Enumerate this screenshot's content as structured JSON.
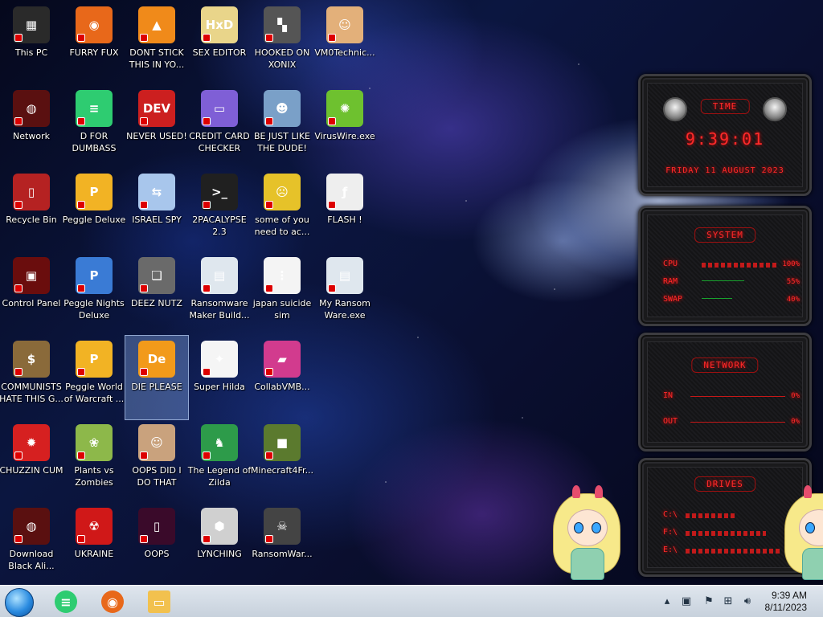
{
  "desktop": {
    "icons": [
      {
        "label": "This PC",
        "color": "#2a2a2a",
        "glyph": "▦"
      },
      {
        "label": "FURRY FUX",
        "color": "#e8681a",
        "glyph": "◉"
      },
      {
        "label": "DONT STICK THIS IN YO...",
        "color": "#f08a1a",
        "glyph": "▲"
      },
      {
        "label": "SEX EDITOR",
        "color": "#e9d58a",
        "glyph": "HxD"
      },
      {
        "label": "HOOKED ON XONIX",
        "color": "#555555",
        "glyph": "▚"
      },
      {
        "label": "VM0Technic...",
        "color": "#e3b07a",
        "glyph": "☺"
      },
      {
        "label": "Network",
        "color": "#5a1010",
        "glyph": "◍"
      },
      {
        "label": "D FOR DUMBASS",
        "color": "#2ecc71",
        "glyph": "≡"
      },
      {
        "label": "NEVER USED!",
        "color": "#cc1f1f",
        "glyph": "DEV"
      },
      {
        "label": "CREDIT CARD CHECKER",
        "color": "#7f5fd6",
        "glyph": "▭"
      },
      {
        "label": "BE JUST LIKE THE DUDE!",
        "color": "#7aa0c8",
        "glyph": "☻"
      },
      {
        "label": "VirusWire.exe",
        "color": "#6ec12f",
        "glyph": "✺"
      },
      {
        "label": "Recycle Bin",
        "color": "#b52222",
        "glyph": "▯"
      },
      {
        "label": "Peggle Deluxe",
        "color": "#f2b324",
        "glyph": "P"
      },
      {
        "label": "ISRAEL SPY",
        "color": "#a8c6ec",
        "glyph": "⇆"
      },
      {
        "label": "2PACALYPSE 2.3",
        "color": "#202020",
        "glyph": ">_"
      },
      {
        "label": "some of you need to ac...",
        "color": "#e6c229",
        "glyph": "☹"
      },
      {
        "label": "FLASH !",
        "color": "#eeeeee",
        "glyph": "ƒ"
      },
      {
        "label": "Control Panel",
        "color": "#6a0d0d",
        "glyph": "▣"
      },
      {
        "label": "Peggle Nights Deluxe",
        "color": "#3a7bd5",
        "glyph": "P"
      },
      {
        "label": "DEEZ NUTZ",
        "color": "#6a6a6a",
        "glyph": "❏"
      },
      {
        "label": "Ransomware Maker Build...",
        "color": "#dfe7ee",
        "glyph": "▤"
      },
      {
        "label": "japan suicide sim",
        "color": "#f4f4f4",
        "glyph": "⋮"
      },
      {
        "label": "My Ransom Ware.exe",
        "color": "#dfe7ee",
        "glyph": "▤"
      },
      {
        "label": "COMMUNISTS HATE THIS G...",
        "color": "#8a6a3a",
        "glyph": "$"
      },
      {
        "label": "Peggle World of Warcraft ...",
        "color": "#f2b324",
        "glyph": "P"
      },
      {
        "label": "DIE PLEASE",
        "color": "#f29a1a",
        "glyph": "De"
      },
      {
        "label": "Super Hilda",
        "color": "#f5f5f5",
        "glyph": "✦"
      },
      {
        "label": "CollabVMB...",
        "color": "#d23b8e",
        "glyph": "▰"
      },
      {
        "label": "",
        "color": "transparent",
        "glyph": ""
      },
      {
        "label": "CHUZZIN CUM",
        "color": "#d62020",
        "glyph": "✹"
      },
      {
        "label": "Plants vs Zombies",
        "color": "#8db84a",
        "glyph": "❀"
      },
      {
        "label": "OOPS DID I DO THAT",
        "color": "#c9a27d",
        "glyph": "☺"
      },
      {
        "label": "The Legend of Zilda",
        "color": "#2d9b4a",
        "glyph": "♞"
      },
      {
        "label": "Minecraft4Fr...",
        "color": "#5b7a2e",
        "glyph": "■"
      },
      {
        "label": "",
        "color": "transparent",
        "glyph": ""
      },
      {
        "label": "Download Black Ali...",
        "color": "#5a1010",
        "glyph": "◍"
      },
      {
        "label": "UKRAINE",
        "color": "#d01818",
        "glyph": "☢"
      },
      {
        "label": "OOPS",
        "color": "#3a0a2a",
        "glyph": "▯"
      },
      {
        "label": "LYNCHING",
        "color": "#d0d0d0",
        "glyph": "⬢"
      },
      {
        "label": "RansomWar...",
        "color": "#444444",
        "glyph": "☠"
      },
      {
        "label": "",
        "color": "transparent",
        "glyph": ""
      }
    ]
  },
  "widgets": {
    "time": {
      "title": "TIME",
      "clock": "9:39:01",
      "date": "FRIDAY 11 AUGUST 2023"
    },
    "system": {
      "title": "SYSTEM",
      "rows": [
        {
          "label": "CPU",
          "value": "100%",
          "fraction": 1.0
        },
        {
          "label": "RAM",
          "value": "55%",
          "fraction": 0.55
        },
        {
          "label": "SWAP",
          "value": "40%",
          "fraction": 0.4
        }
      ]
    },
    "network": {
      "title": "NETWORK",
      "rows": [
        {
          "label": "IN",
          "value": "0%"
        },
        {
          "label": "OUT",
          "value": "0%"
        }
      ]
    },
    "drives": {
      "title": "DRIVES",
      "rows": [
        {
          "label": "C:\\",
          "value": "3"
        },
        {
          "label": "F:\\",
          "value": "10"
        },
        {
          "label": "E:\\",
          "value": ""
        }
      ]
    }
  },
  "taskbar": {
    "pinned": [
      {
        "name": "spotify-icon",
        "color": "#2ecc71",
        "glyph": "≡"
      },
      {
        "name": "firefox-icon",
        "color": "#e8681a",
        "glyph": "◉"
      },
      {
        "name": "file-explorer-icon",
        "color": "#f2c14e",
        "glyph": "▭"
      }
    ],
    "tray": {
      "time": "9:39 AM",
      "date": "8/11/2023"
    }
  }
}
